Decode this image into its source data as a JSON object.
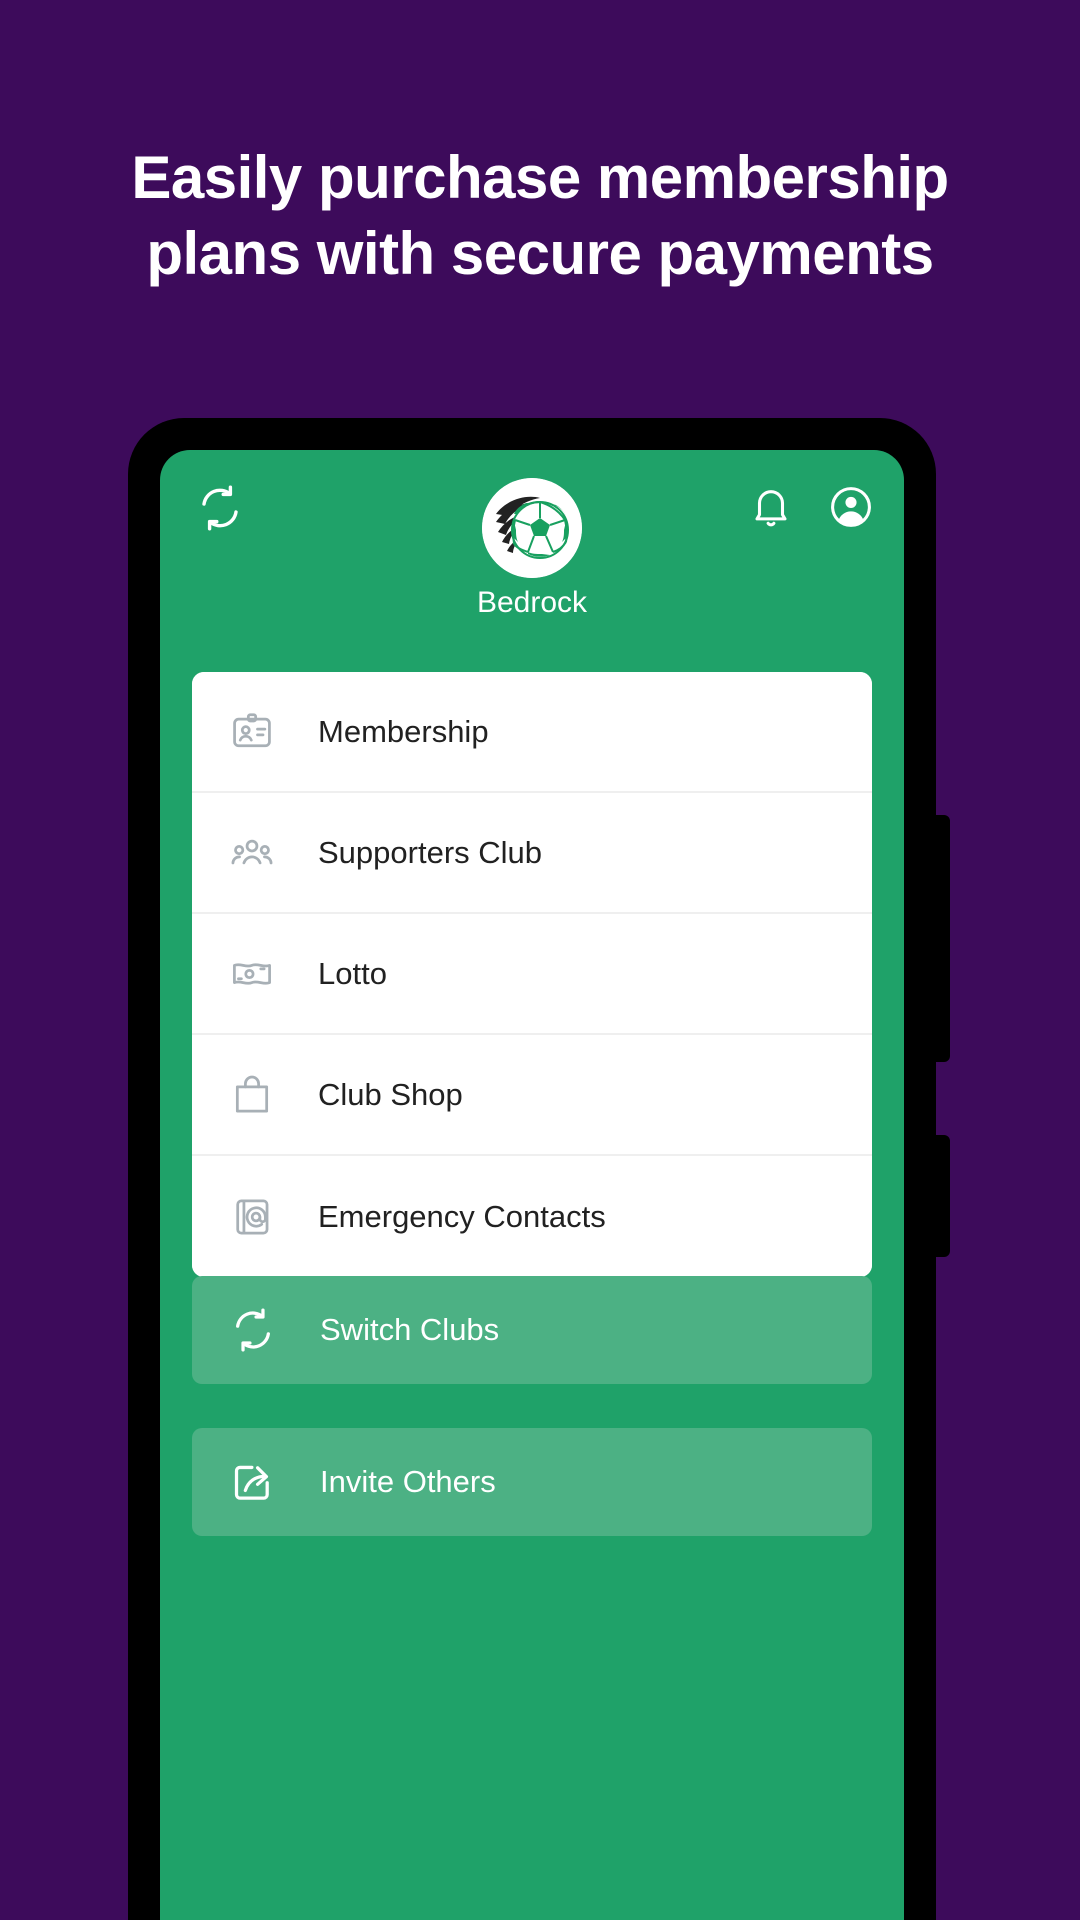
{
  "promo": {
    "background_color": "#3D0B5B",
    "headline_line1": "Easily purchase membership",
    "headline_line2": "plans with secure payments"
  },
  "app": {
    "brand_color": "#1FA269",
    "button_color": "#4CB184",
    "card_color": "#FFFFFF",
    "header": {
      "switch_icon_name": "switch-clubs-icon",
      "notifications_icon_name": "bell-icon",
      "account_icon_name": "account-circle-icon",
      "logo_icon_name": "soccer-ball-logo",
      "club_name": "Bedrock"
    },
    "menu": {
      "items": [
        {
          "label": "Membership",
          "icon": "id-badge-icon"
        },
        {
          "label": "Supporters Club",
          "icon": "people-group-icon"
        },
        {
          "label": "Lotto",
          "icon": "banknote-icon"
        },
        {
          "label": "Club Shop",
          "icon": "shopping-bag-icon"
        },
        {
          "label": "Emergency Contacts",
          "icon": "contact-book-icon"
        }
      ]
    },
    "actions": [
      {
        "label": "Switch Clubs",
        "icon": "switch-clubs-icon"
      },
      {
        "label": "Invite Others",
        "icon": "share-export-icon"
      }
    ]
  }
}
